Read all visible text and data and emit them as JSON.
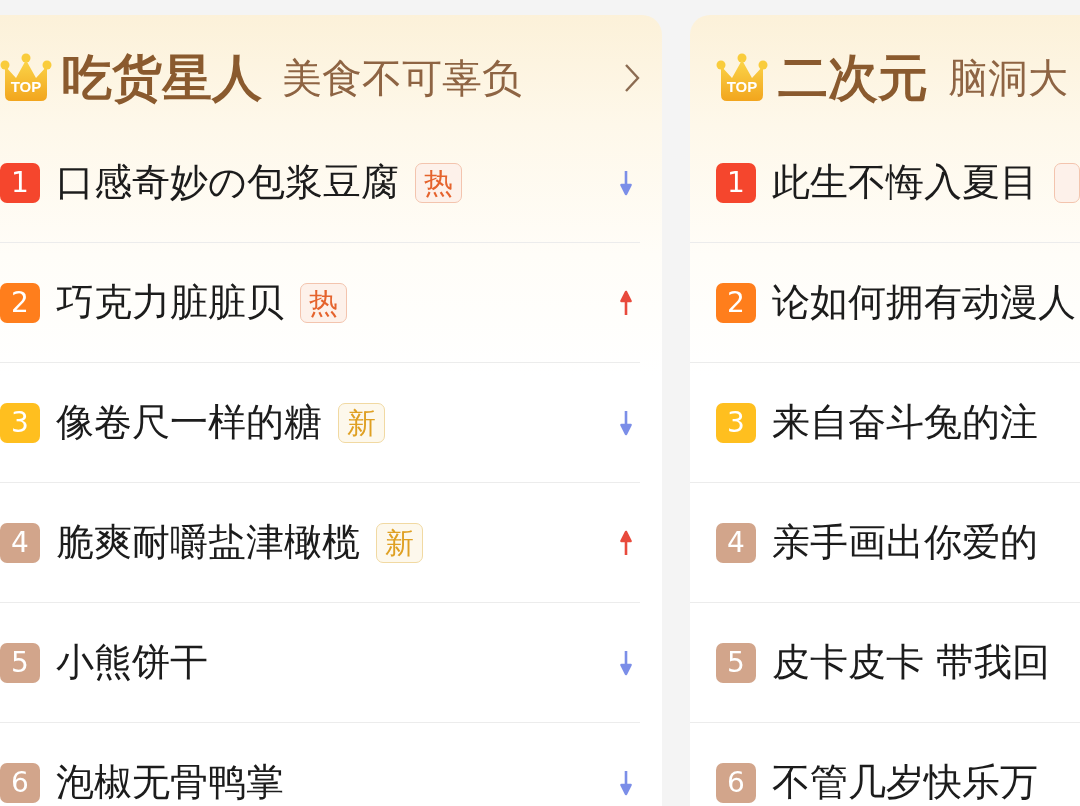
{
  "cards": [
    {
      "crown_label": "TOP",
      "title": "吃货星人",
      "subtitle": "美食不可辜负",
      "more_link": true,
      "items": [
        {
          "rank": "1",
          "color": "#f5462d",
          "title": "口感奇妙の包浆豆腐",
          "tag": {
            "kind": "hot",
            "label": "热"
          },
          "rising": false
        },
        {
          "rank": "2",
          "color": "#ff7e1c",
          "title": "巧克力脏脏贝",
          "tag": {
            "kind": "hot",
            "label": "热"
          },
          "rising": true
        },
        {
          "rank": "3",
          "color": "#ffbf1f",
          "title": "像卷尺一样的糖",
          "tag": {
            "kind": "new",
            "label": "新"
          },
          "rising": false
        },
        {
          "rank": "4",
          "color": "#d2a58b",
          "title": "脆爽耐嚼盐津橄榄",
          "tag": {
            "kind": "new",
            "label": "新"
          },
          "rising": true
        },
        {
          "rank": "5",
          "color": "#d2a58b",
          "title": "小熊饼干",
          "rising": false
        },
        {
          "rank": "6",
          "color": "#d2a58b",
          "title": "泡椒无骨鸭掌",
          "rising": false
        }
      ]
    },
    {
      "crown_label": "TOP",
      "title": "二次元",
      "subtitle": "脑洞大",
      "more_link": false,
      "items": [
        {
          "rank": "1",
          "color": "#f5462d",
          "title": "此生不悔入夏目",
          "tag": {
            "kind": "hot"
          }
        },
        {
          "rank": "2",
          "color": "#ff7e1c",
          "title": "论如何拥有动漫人"
        },
        {
          "rank": "3",
          "color": "#ffbf1f",
          "title": "来自奋斗兔的注"
        },
        {
          "rank": "4",
          "color": "#d2a58b",
          "title": "亲手画出你爱的"
        },
        {
          "rank": "5",
          "color": "#d2a58b",
          "title": "皮卡皮卡 带我回"
        },
        {
          "rank": "6",
          "color": "#d2a58b",
          "title": "不管几岁快乐万"
        }
      ]
    }
  ]
}
